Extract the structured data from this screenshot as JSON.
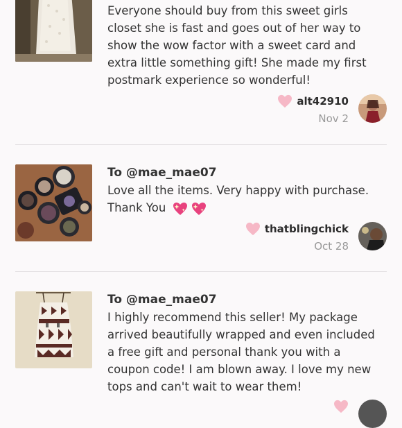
{
  "reviews": [
    {
      "to": "",
      "text": "Everyone should buy from this sweet girls closet she is fast and goes out of her way to show the wow factor with a sweet card and extra little something gift! She made my first postmark experience so wonderful!",
      "username": "alt42910",
      "date": "Nov 2",
      "thumb_icon": "white-lace-dress-photo",
      "avatar_icon": "user-avatar-photo"
    },
    {
      "to": "To @mae_mae07",
      "text": "Love all the items. Very happy with purchase. Thank You",
      "emoji": "sparkling-heart-emoji",
      "username": "thatblingchick",
      "date": "Oct 28",
      "thumb_icon": "eyeshadow-palettes-photo",
      "avatar_icon": "user-avatar-photo"
    },
    {
      "to": "To @mae_mae07",
      "text": "I highly recommend this seller! My package arrived beautifully wrapped and even included a free gift and personal thank you with a coupon code! I am blown away. I love my new tops and can't wait to wear them!",
      "thumb_icon": "patterned-tank-top-photo"
    }
  ],
  "colors": {
    "heart": "#f6b8c6",
    "emoji_heart": "#e8427e",
    "divider": "#e3e0e2",
    "date": "#999999"
  }
}
